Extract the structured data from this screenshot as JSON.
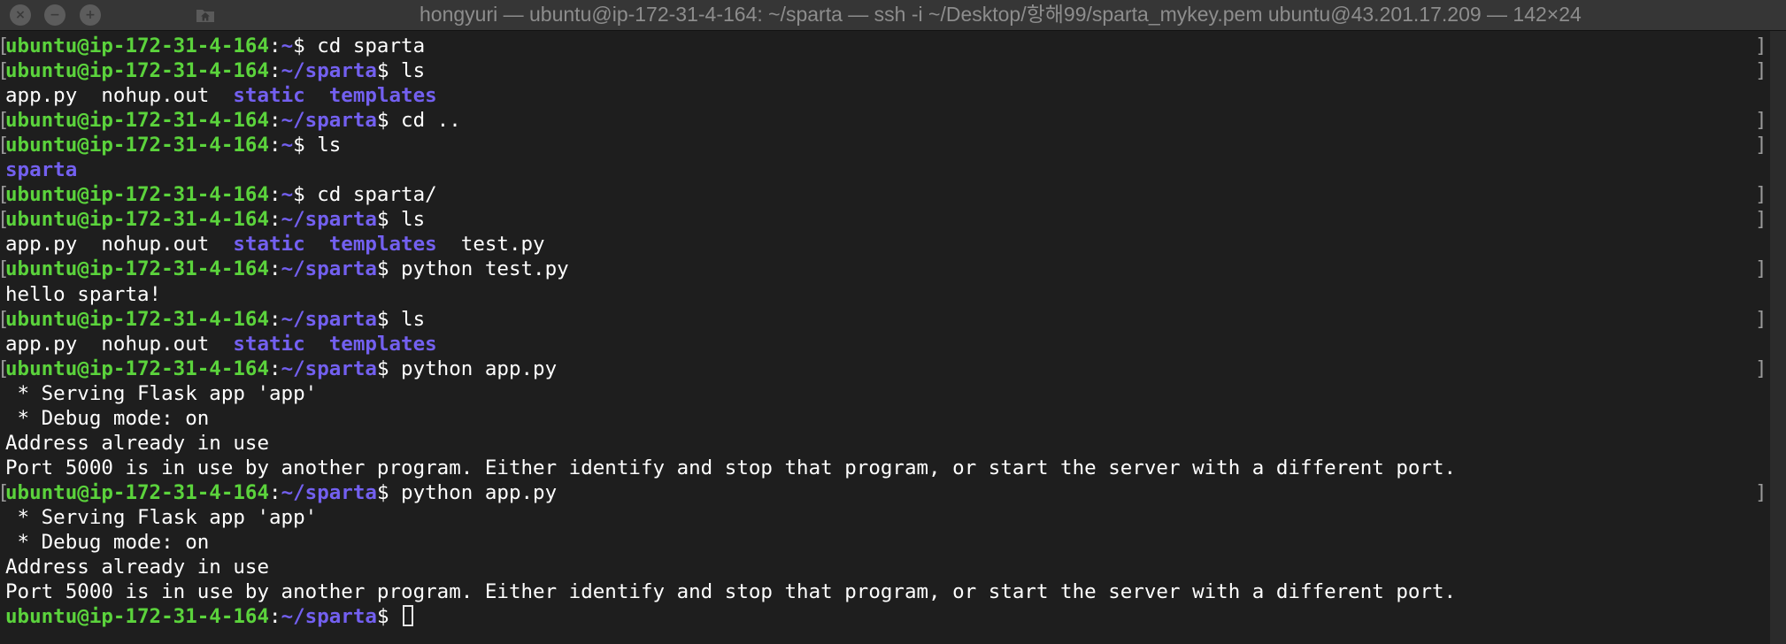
{
  "window": {
    "title": "hongyuri — ubuntu@ip-172-31-4-164: ~/sparta — ssh -i ~/Desktop/항해99/sparta_mykey.pem ubuntu@43.201.17.209 — 142×24"
  },
  "colors": {
    "background": "#1e1e1e",
    "titlebar": "#363636",
    "user_host": "#5bd33c",
    "path": "#7360f0",
    "directory": "#7360f0",
    "text": "#ffffff"
  },
  "icons": {
    "title": "home-folder-icon",
    "traffic": [
      "close-icon",
      "minimize-icon",
      "zoom-icon"
    ]
  },
  "terminal": {
    "lines": [
      {
        "type": "prompt",
        "user_host": "ubuntu@ip-172-31-4-164",
        "colon": ":",
        "path": "~",
        "dollar": "$ ",
        "command": "cd sparta",
        "marked": true
      },
      {
        "type": "prompt",
        "user_host": "ubuntu@ip-172-31-4-164",
        "colon": ":",
        "path": "~/sparta",
        "dollar": "$ ",
        "command": "ls",
        "marked": true
      },
      {
        "type": "ls",
        "entries": [
          {
            "name": "app.py",
            "dir": false
          },
          {
            "name": "nohup.out",
            "dir": false
          },
          {
            "name": "static",
            "dir": true
          },
          {
            "name": "templates",
            "dir": true
          }
        ]
      },
      {
        "type": "prompt",
        "user_host": "ubuntu@ip-172-31-4-164",
        "colon": ":",
        "path": "~/sparta",
        "dollar": "$ ",
        "command": "cd ..",
        "marked": true
      },
      {
        "type": "prompt",
        "user_host": "ubuntu@ip-172-31-4-164",
        "colon": ":",
        "path": "~",
        "dollar": "$ ",
        "command": "ls",
        "marked": true
      },
      {
        "type": "ls",
        "entries": [
          {
            "name": "sparta",
            "dir": true
          }
        ]
      },
      {
        "type": "prompt",
        "user_host": "ubuntu@ip-172-31-4-164",
        "colon": ":",
        "path": "~",
        "dollar": "$ ",
        "command": "cd sparta/",
        "marked": true
      },
      {
        "type": "prompt",
        "user_host": "ubuntu@ip-172-31-4-164",
        "colon": ":",
        "path": "~/sparta",
        "dollar": "$ ",
        "command": "ls",
        "marked": true
      },
      {
        "type": "ls",
        "entries": [
          {
            "name": "app.py",
            "dir": false
          },
          {
            "name": "nohup.out",
            "dir": false
          },
          {
            "name": "static",
            "dir": true
          },
          {
            "name": "templates",
            "dir": true
          },
          {
            "name": "test.py",
            "dir": false
          }
        ]
      },
      {
        "type": "prompt",
        "user_host": "ubuntu@ip-172-31-4-164",
        "colon": ":",
        "path": "~/sparta",
        "dollar": "$ ",
        "command": "python test.py",
        "marked": true
      },
      {
        "type": "output",
        "text": "hello sparta!"
      },
      {
        "type": "prompt",
        "user_host": "ubuntu@ip-172-31-4-164",
        "colon": ":",
        "path": "~/sparta",
        "dollar": "$ ",
        "command": "ls",
        "marked": true
      },
      {
        "type": "ls",
        "entries": [
          {
            "name": "app.py",
            "dir": false
          },
          {
            "name": "nohup.out",
            "dir": false
          },
          {
            "name": "static",
            "dir": true
          },
          {
            "name": "templates",
            "dir": true
          }
        ]
      },
      {
        "type": "prompt",
        "user_host": "ubuntu@ip-172-31-4-164",
        "colon": ":",
        "path": "~/sparta",
        "dollar": "$ ",
        "command": "python app.py",
        "marked": true
      },
      {
        "type": "output",
        "text": " * Serving Flask app 'app'"
      },
      {
        "type": "output",
        "text": " * Debug mode: on"
      },
      {
        "type": "output",
        "text": "Address already in use"
      },
      {
        "type": "output",
        "text": "Port 5000 is in use by another program. Either identify and stop that program, or start the server with a different port."
      },
      {
        "type": "prompt",
        "user_host": "ubuntu@ip-172-31-4-164",
        "colon": ":",
        "path": "~/sparta",
        "dollar": "$ ",
        "command": "python app.py",
        "marked": true
      },
      {
        "type": "output",
        "text": " * Serving Flask app 'app'"
      },
      {
        "type": "output",
        "text": " * Debug mode: on"
      },
      {
        "type": "output",
        "text": "Address already in use"
      },
      {
        "type": "output",
        "text": "Port 5000 is in use by another program. Either identify and stop that program, or start the server with a different port."
      },
      {
        "type": "prompt",
        "user_host": "ubuntu@ip-172-31-4-164",
        "colon": ":",
        "path": "~/sparta",
        "dollar": "$ ",
        "command": "",
        "marked": false,
        "cursor": true
      }
    ]
  }
}
